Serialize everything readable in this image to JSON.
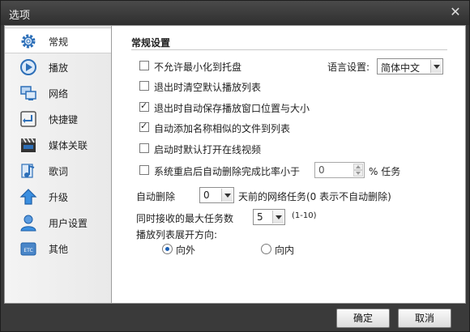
{
  "window": {
    "title": "选项"
  },
  "sidebar": {
    "items": [
      {
        "label": "常规",
        "icon": "gear-icon"
      },
      {
        "label": "播放",
        "icon": "play-icon"
      },
      {
        "label": "网络",
        "icon": "network-icon"
      },
      {
        "label": "快捷键",
        "icon": "keyboard-enter-icon"
      },
      {
        "label": "媒体关联",
        "icon": "film-clapper-icon"
      },
      {
        "label": "歌词",
        "icon": "music-note-icon"
      },
      {
        "label": "升级",
        "icon": "upgrade-arrow-icon"
      },
      {
        "label": "用户设置",
        "icon": "user-icon"
      },
      {
        "label": "其他",
        "icon": "etc-icon"
      }
    ],
    "active_index": 0
  },
  "general": {
    "section_title": "常规设置",
    "options": [
      {
        "label": "不允许最小化到托盘",
        "checked": false
      },
      {
        "label": "退出时清空默认播放列表",
        "checked": false
      },
      {
        "label": "退出时自动保存播放窗口位置与大小",
        "checked": true
      },
      {
        "label": "自动添加名称相似的文件到列表",
        "checked": true
      },
      {
        "label": "启动时默认打开在线视频",
        "checked": false
      }
    ],
    "language": {
      "label": "语言设置:",
      "value": "简体中文"
    },
    "auto_delete_ratio": {
      "label": "系统重启后自动删除完成比率小于",
      "checked": false,
      "value": "0",
      "unit": "% 任务"
    },
    "auto_delete_days": {
      "label": "自动删除",
      "value": "0",
      "suffix": "天前的网络任务(0 表示不自动删除)"
    },
    "max_tasks": {
      "label": "同时接收的最大任务数",
      "value": "5",
      "range": "(1-10)"
    },
    "playlist_direction": {
      "label": "播放列表展开方向:",
      "options": [
        {
          "label": "向外",
          "selected": true
        },
        {
          "label": "向内",
          "selected": false
        }
      ]
    }
  },
  "footer": {
    "ok_label": "确定",
    "cancel_label": "取消"
  },
  "colors": {
    "accent": "#1a5fb4",
    "titlebar": "#3a3a3a"
  }
}
